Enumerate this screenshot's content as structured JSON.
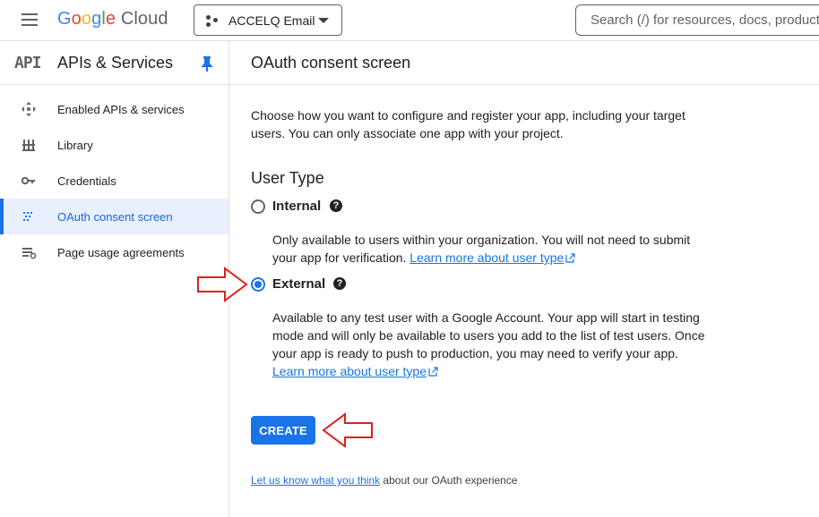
{
  "header": {
    "logo_google": "Google",
    "logo_cloud": "Cloud",
    "project_name": "ACCELQ Email",
    "search_placeholder": "Search (/) for resources, docs, products"
  },
  "sidebar": {
    "api_badge": "API",
    "title": "APIs & Services",
    "items": [
      {
        "label": "Enabled APIs & services",
        "icon": "hub-icon",
        "active": false
      },
      {
        "label": "Library",
        "icon": "library-icon",
        "active": false
      },
      {
        "label": "Credentials",
        "icon": "key-icon",
        "active": false
      },
      {
        "label": "OAuth consent screen",
        "icon": "consent-icon",
        "active": true
      },
      {
        "label": "Page usage agreements",
        "icon": "settings-list-icon",
        "active": false
      }
    ]
  },
  "main": {
    "title": "OAuth consent screen",
    "intro": "Choose how you want to configure and register your app, including your target users. You can only associate one app with your project.",
    "user_type_title": "User Type",
    "options": [
      {
        "label": "Internal",
        "checked": false,
        "description": "Only available to users within your organization. You will not need to submit your app for verification.",
        "link": "Learn more about user type"
      },
      {
        "label": "External",
        "checked": true,
        "description": "Available to any test user with a Google Account. Your app will start in testing mode and will only be available to users you add to the list of test users. Once your app is ready to push to production, you may need to verify your app.",
        "link": "Learn more about user type"
      }
    ],
    "create_label": "CREATE",
    "feedback_link": "Let us know what you think",
    "feedback_text": " about our OAuth experience"
  },
  "colors": {
    "accent": "#1a73e8",
    "annotation_arrow": "#e0201b"
  }
}
